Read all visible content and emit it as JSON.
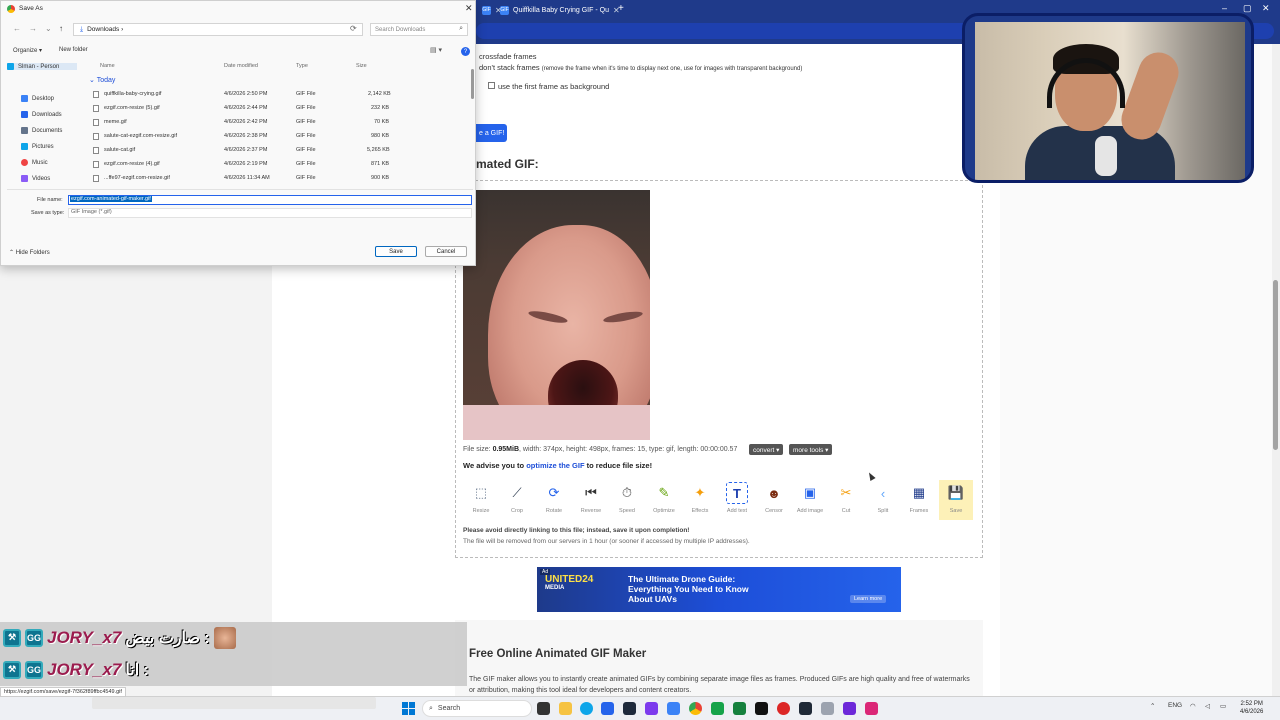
{
  "browser": {
    "tabs": [
      {
        "label": "",
        "favicon": "GIF"
      },
      {
        "label": "Quiffkilla Baby Crying GIF - Qu",
        "favicon": "GIF"
      }
    ],
    "new_tab": "+"
  },
  "page": {
    "options": {
      "crossfade": "crossfade frames",
      "dont_stack_label": "don't stack frames",
      "dont_stack_hint": "(remove the frame when it's time to display next one, use for images with transparent background)",
      "first_frame_bg": "use the first frame as background"
    },
    "make_button": "e a GIF!",
    "section_title": "mated GIF:",
    "file_info": {
      "prefix": "File size: ",
      "size": "0.95MiB",
      "rest": ", width: 374px, height: 498px, frames: 15, type: gif, length: 00:00:00.57"
    },
    "convert_btn": "convert ▾",
    "more_tools_btn": "more tools ▾",
    "advise": {
      "pre": "We advise you to ",
      "link": "optimize the GIF",
      "post": " to reduce file size!"
    },
    "tools": [
      {
        "label": "Resize",
        "icon": "resize-icon",
        "glyph": "⬚"
      },
      {
        "label": "Crop",
        "icon": "crop-icon",
        "glyph": "⟋"
      },
      {
        "label": "Rotate",
        "icon": "rotate-icon",
        "glyph": "⟳"
      },
      {
        "label": "Reverse",
        "icon": "reverse-icon",
        "glyph": "⏮"
      },
      {
        "label": "Speed",
        "icon": "speed-icon",
        "glyph": "⏱"
      },
      {
        "label": "Optimize",
        "icon": "optimize-icon",
        "glyph": "✎"
      },
      {
        "label": "Effects",
        "icon": "effects-icon",
        "glyph": "✦"
      },
      {
        "label": "Add text",
        "icon": "add-text-icon",
        "glyph": "T"
      },
      {
        "label": "Censor",
        "icon": "censor-icon",
        "glyph": "☻"
      },
      {
        "label": "Add image",
        "icon": "add-image-icon",
        "glyph": "▣"
      },
      {
        "label": "Cut",
        "icon": "cut-icon",
        "glyph": "✂"
      },
      {
        "label": "Split",
        "icon": "split-icon",
        "glyph": "‹"
      },
      {
        "label": "Frames",
        "icon": "frames-icon",
        "glyph": "▦"
      },
      {
        "label": "Save",
        "icon": "save-icon",
        "glyph": "💾"
      }
    ],
    "warning_bold": "Please avoid directly linking to this file; instead, save it upon completion!",
    "warning_text": "The file will be removed from our servers in 1 hour (or sooner if accessed by multiple IP addresses).",
    "ad": {
      "label": "Ad",
      "brand": "UNITED24",
      "brand_sub": "MEDIA",
      "headline": "The Ultimate Drone Guide: Everything You Need to Know About UAVs",
      "cta": "Learn more"
    },
    "free_title": "Free Online Animated GIF Maker",
    "free_text": "The GIF maker allows you to instantly create animated GIFs by combining separate image files as frames. Produced GIFs are high quality and free of watermarks or attribution, making this tool ideal for developers and content creators."
  },
  "dialog": {
    "title": "Save As",
    "address": "Downloads  ›",
    "search_placeholder": "Search Downloads",
    "organize": "Organize ▾",
    "new_folder": "New folder",
    "nav": [
      {
        "label": "Slman - Person",
        "selected": true,
        "color": "#0ea5e9"
      },
      {
        "label": "Desktop",
        "color": "#3b82f6"
      },
      {
        "label": "Downloads",
        "color": "#2563eb"
      },
      {
        "label": "Documents",
        "color": "#64748b"
      },
      {
        "label": "Pictures",
        "color": "#0ea5e9"
      },
      {
        "label": "Music",
        "color": "#ef4444"
      },
      {
        "label": "Videos",
        "color": "#8b5cf6"
      }
    ],
    "columns": {
      "name": "Name",
      "date": "Date modified",
      "type": "Type",
      "size": "Size"
    },
    "group": "Today",
    "files": [
      {
        "name": "quiffkilla-baby-crying.gif",
        "date": "4/6/2026 2:50 PM",
        "type": "GIF File",
        "size": "2,142 KB"
      },
      {
        "name": "ezgif.com-resize (5).gif",
        "date": "4/6/2026 2:44 PM",
        "type": "GIF File",
        "size": "232 KB"
      },
      {
        "name": "meme.gif",
        "date": "4/6/2026 2:42 PM",
        "type": "GIF File",
        "size": "70 KB"
      },
      {
        "name": "salute-cat-ezgif.com-resize.gif",
        "date": "4/6/2026 2:38 PM",
        "type": "GIF File",
        "size": "980 KB"
      },
      {
        "name": "salute-cat.gif",
        "date": "4/6/2026 2:37 PM",
        "type": "GIF File",
        "size": "5,265 KB"
      },
      {
        "name": "ezgif.com-resize (4).gif",
        "date": "4/6/2026 2:19 PM",
        "type": "GIF File",
        "size": "871 KB"
      },
      {
        "name": "...ffe97-ezgif.com-resize.gif",
        "date": "4/6/2026 11:34 AM",
        "type": "GIF File",
        "size": "900 KB"
      }
    ],
    "filename_label": "File name:",
    "filename_value": "ezgif.com-animated-gif-maker.gif",
    "savetype_label": "Save as type:",
    "savetype_value": "GIF Image (*.gif)",
    "hide_folders": "Hide Folders",
    "save_btn": "Save",
    "cancel_btn": "Cancel"
  },
  "chat": [
    {
      "user": "JORY_x7",
      "message": "صارت بيض :"
    },
    {
      "user": "JORY_x7",
      "message": "انا :"
    }
  ],
  "status_url": "https://ezgif.com/save/ezgif-7f362f89ffbc4549.gif",
  "taskbar": {
    "search": "Search",
    "lang": "ENG",
    "time": "2:52 PM",
    "date": "4/6/2026"
  }
}
